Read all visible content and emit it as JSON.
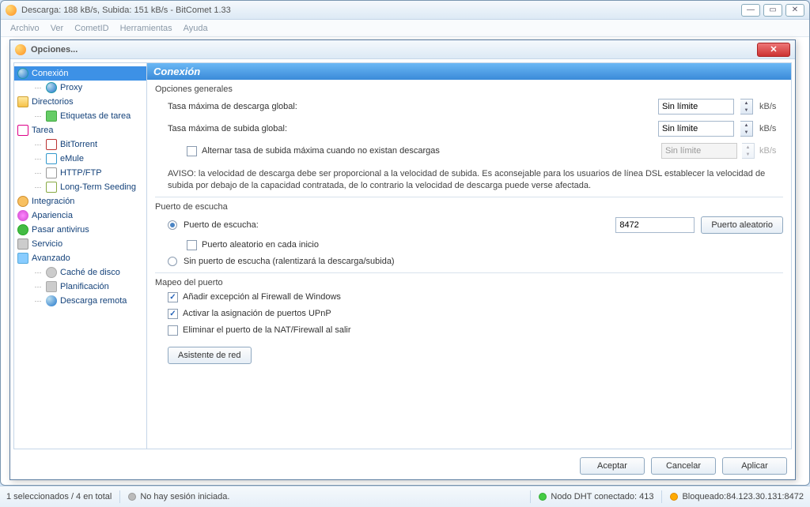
{
  "main_window": {
    "title": "Descarga: 188 kB/s, Subida: 151 kB/s - BitComet 1.33",
    "menu": [
      "Archivo",
      "Ver",
      "CometID",
      "Herramientas",
      "Ayuda"
    ]
  },
  "dialog": {
    "title": "Opciones...",
    "tree": {
      "conexion": "Conexión",
      "proxy": "Proxy",
      "directorios": "Directorios",
      "etiquetas": "Etiquetas de tarea",
      "tarea": "Tarea",
      "bittorrent": "BitTorrent",
      "emule": "eMule",
      "httpftp": "HTTP/FTP",
      "longterm": "Long-Term Seeding",
      "integracion": "Integración",
      "apariencia": "Apariencia",
      "antivirus": "Pasar antivirus",
      "servicio": "Servicio",
      "avanzado": "Avanzado",
      "cache": "Caché de disco",
      "planif": "Planificación",
      "remota": "Descarga remota"
    },
    "content": {
      "header": "Conexión",
      "sec_generales": "Opciones generales",
      "max_down_label": "Tasa máxima de descarga global:",
      "max_down_value": "Sin límite",
      "max_up_label": "Tasa máxima de subida global:",
      "max_up_value": "Sin límite",
      "alt_up_chk": "Alternar tasa de subida máxima cuando no existan descargas",
      "alt_up_value": "Sin límite",
      "unit": "kB/s",
      "aviso": "AVISO: la velocidad de descarga debe ser proporcional a la velocidad de subida. Es aconsejable para los usuarios de línea DSL establecer la velocidad de subida por debajo de la capacidad contratada, de lo contrario la velocidad de descarga puede verse afectada.",
      "sec_puerto": "Puerto de escucha",
      "puerto_radio": "Puerto de escucha:",
      "puerto_value": "8472",
      "puerto_aleatorio_btn": "Puerto aleatorio",
      "puerto_aleatorio_chk": "Puerto aleatorio en cada inicio",
      "sin_puerto_radio": "Sin puerto de escucha (ralentizará la descarga/subida)",
      "sec_mapeo": "Mapeo del puerto",
      "firewall_chk": "Añadir excepción al Firewall de Windows",
      "upnp_chk": "Activar la asignación de puertos UPnP",
      "nat_chk": "Eliminar el puerto de la NAT/Firewall al salir",
      "asistente_btn": "Asistente de red"
    },
    "buttons": {
      "ok": "Aceptar",
      "cancel": "Cancelar",
      "apply": "Aplicar"
    }
  },
  "status": {
    "selection": "1 seleccionados / 4 en total",
    "session": "No hay sesión iniciada.",
    "dht": "Nodo DHT conectado: 413",
    "blocked": "Bloqueado:84.123.30.131:8472"
  }
}
